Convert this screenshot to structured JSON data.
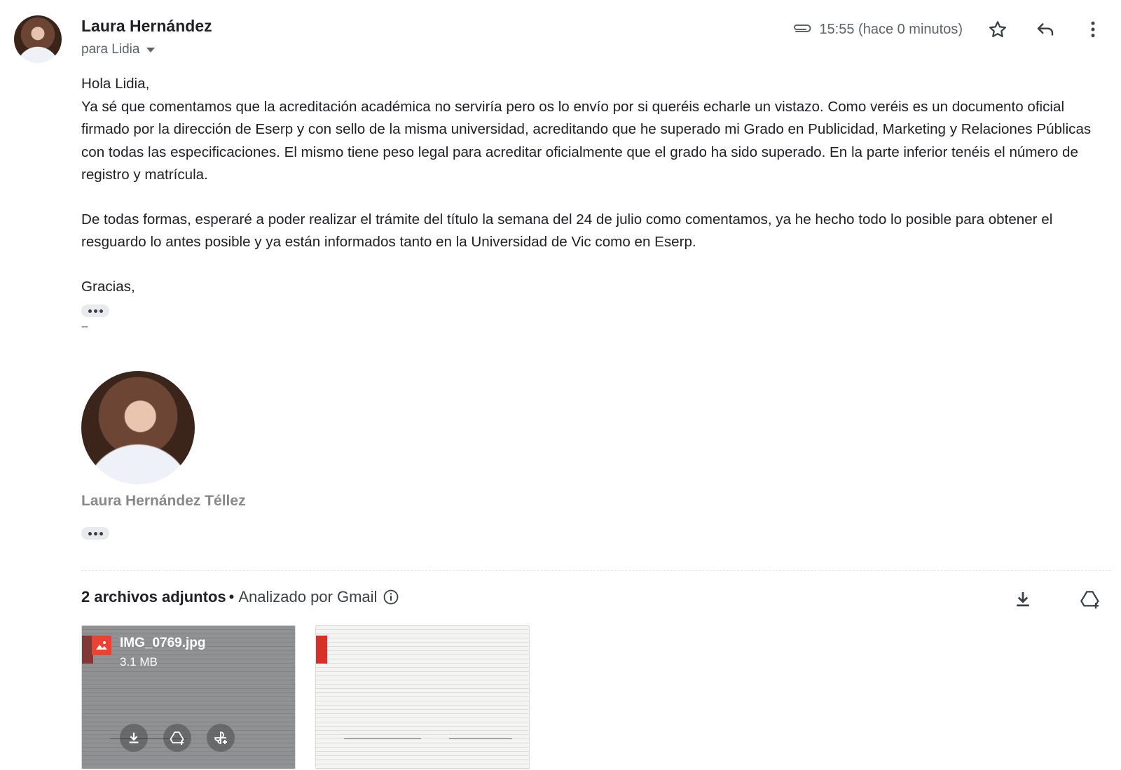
{
  "header": {
    "sender_name": "Laura Hernández",
    "recipient": "para Lidia",
    "timestamp": "15:55 (hace 0 minutos)"
  },
  "body": {
    "greeting": "Hola Lidia,",
    "paragraph1": "Ya sé que comentamos que la acreditación académica no serviría pero os lo envío por si queréis echarle un vistazo. Como veréis es un documento oficial firmado por la dirección de Eserp y con sello de la misma universidad, acreditando que he superado mi Grado en Publicidad, Marketing y Relaciones Públicas con todas las especificaciones. El mismo tiene peso legal para acreditar oficialmente que el grado ha sido superado. En la parte inferior tenéis el número de registro y matrícula.",
    "paragraph2": "De todas formas, esperaré a poder realizar el trámite del título la semana del 24 de julio como comentamos, ya he hecho todo lo posible para obtener el resguardo lo antes posible y ya están informados tanto en la Universidad de Vic como en Eserp.",
    "closing": "Gracias,"
  },
  "signature": {
    "dashes": "--",
    "name": "Laura Hernández Téllez"
  },
  "attachments": {
    "count_label": "2 archivos adjuntos",
    "separator": "•",
    "scanned_label": "Analizado por Gmail",
    "files": [
      {
        "name": "IMG_0769.jpg",
        "size": "3.1 MB"
      }
    ]
  },
  "icons": {
    "attachment": "paperclip-icon",
    "star": "star-icon",
    "reply": "reply-icon",
    "more": "more-vert-icon",
    "info": "info-icon",
    "download": "download-icon",
    "drive": "add-to-drive-icon",
    "photos": "add-to-photos-icon"
  }
}
